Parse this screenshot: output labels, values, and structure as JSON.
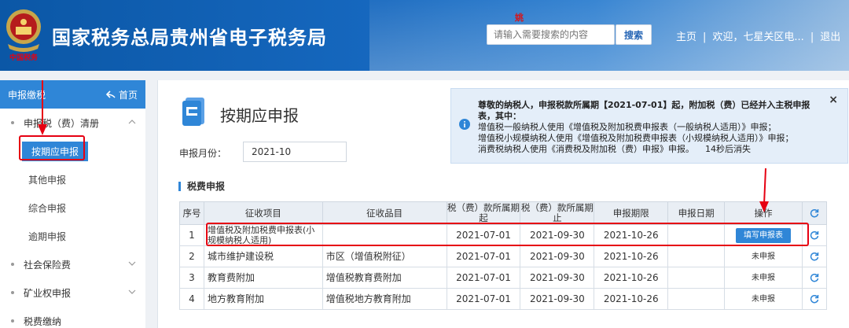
{
  "header": {
    "site_title": "国家税务总局贵州省电子税务局",
    "emblem_text": "中国税务",
    "badge": "姚",
    "search_placeholder": "请输入需要搜索的内容",
    "search_label": "搜索",
    "nav_home": "主页",
    "nav_welcome": "欢迎，七星关区电...",
    "nav_logout": "退出"
  },
  "sidebar": {
    "head_title": "申报缴税",
    "head_home": "首页",
    "groups": [
      {
        "label": "申报税（费）清册"
      },
      {
        "label": "社会保险费"
      },
      {
        "label": "矿业权申报"
      },
      {
        "label": "税费缴纳"
      }
    ],
    "items": [
      {
        "label": "按期应申报"
      },
      {
        "label": "其他申报"
      },
      {
        "label": "综合申报"
      },
      {
        "label": "逾期申报"
      }
    ]
  },
  "main": {
    "page_title": "按期应申报",
    "month_label": "申报月份：",
    "month_value": "2021-10",
    "section_title": "税费申报"
  },
  "notice": {
    "line1": "尊敬的纳税人，申报税款所属期【2021-07-01】起，附加税（费）已经并入主税申报表，其中：",
    "line2": "增值税一般纳税人使用《增值税及附加税费申报表（一般纳税人适用）》申报；",
    "line3": "增值税小规模纳税人使用《增值税及附加税费申报表（小规模纳税人适用）》申报；",
    "line4": "消费税纳税人使用《消费税及附加税（费）申报》申报。",
    "countdown": "14秒后消失",
    "close": "×"
  },
  "table": {
    "headers": [
      "序号",
      "征收项目",
      "征收品目",
      "税（费）款所属期起",
      "税（费）款所属期止",
      "申报期限",
      "申报日期",
      "操作"
    ],
    "rows": [
      {
        "no": "1",
        "item": "增值税及附加税费申报表(小规模纳税人适用)",
        "sub": "",
        "start": "2021-07-01",
        "end": "2021-09-30",
        "deadline": "2021-10-26",
        "date": "",
        "action": "填写申报表"
      },
      {
        "no": "2",
        "item": "城市维护建设税",
        "sub": "市区（增值税附征）",
        "start": "2021-07-01",
        "end": "2021-09-30",
        "deadline": "2021-10-26",
        "date": "",
        "action": "未申报"
      },
      {
        "no": "3",
        "item": "教育费附加",
        "sub": "增值税教育费附加",
        "start": "2021-07-01",
        "end": "2021-09-30",
        "deadline": "2021-10-26",
        "date": "",
        "action": "未申报"
      },
      {
        "no": "4",
        "item": "地方教育附加",
        "sub": "增值税地方教育附加",
        "start": "2021-07-01",
        "end": "2021-09-30",
        "deadline": "2021-10-26",
        "date": "",
        "action": "未申报"
      }
    ]
  },
  "colors": {
    "header_blue": "#0b57a6",
    "accent_blue": "#2f86d7",
    "highlight_red": "#e60012"
  }
}
